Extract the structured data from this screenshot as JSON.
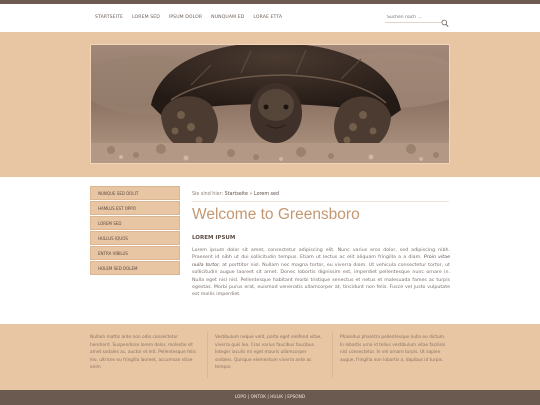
{
  "nav": {
    "items": [
      "Startseite",
      "Lorem sed",
      "Ipsum dolor",
      "Nunquam ed",
      "Lorae etta"
    ]
  },
  "search": {
    "placeholder": "Suchen nach ..."
  },
  "hero": {
    "image_subject": "tortoise"
  },
  "sidebar": {
    "items": [
      "Nunque sed dolit",
      "Hamlus est oppo",
      "Lorem sed",
      "Hullus iquos",
      "Entra vibilus",
      "Holem sed dolem"
    ]
  },
  "breadcrumb": {
    "prefix": "Sie sind hier:",
    "home": "Startseite",
    "separator": "»",
    "current": "Lorem sed"
  },
  "main": {
    "title": "Welcome to Greensboro",
    "subhead": "LOREM IPSUM",
    "paragraph_start": "Lorem ipsum dolor sit amet, consectetur adipiscing elit. Nunc varius eros dolor, sed adipiscing nibh. Praesent id nibh ut dui sollicitudin tempus. Etiam ut lectus ac elit aliquam fringilla a a diam.",
    "paragraph_italic": "Proin vitae nulla tortor,",
    "paragraph_end": "at porttitor nisl. Nullam nec magna tortor, eu viverra diam. Ut vehicula consectetur tortor, ut sollicitudin augue laoreet sit amet. Donec lobortis dignissim est, imperdiet pellentesque nunc ornare in. Nulla eget nisl nisl. Pellentesque habitant morbi tristique senectus et netus et malesuada fames ac turpis egestas. Morbi purus erat, euismod venenatis ullamcorper at, tincidunt non felis. Fusce vel justo vulputate est mollis imperdiet."
  },
  "footer": {
    "columns": [
      "Nullam mattis ante non odio consectetur hendrerit. Suspendisse lorem dolor, molestie sit amet sodales ac, auctor et elit. Pellentesque felis leo, ultrices eu fringilla laoreet, accumsan vitae enim",
      "Vestibulum neque velit, porta eget eleifend vitae, viverra quis leo. Cras varius faucibus faucibus. Integer iaculis mi eget mauris ullamcorper sodales. Quisque elementum viverra ante ac tempor.",
      "Phasellus pharetra pellentesque nulla eu dictum. In lobortis urna id tellus vestibulum vitae facilisis nisl consectetur. In vel ornare turpis. Ut sapien augue, fringilla non lobortis a, dapibus id turpis."
    ]
  },
  "bottom": {
    "links": [
      "Lopo",
      "Ontok",
      "Hulik",
      "Epsond"
    ],
    "separator": "|"
  },
  "colors": {
    "accent": "#e8c5a3",
    "dark_bar": "#6b5a50",
    "title": "#c49871"
  }
}
